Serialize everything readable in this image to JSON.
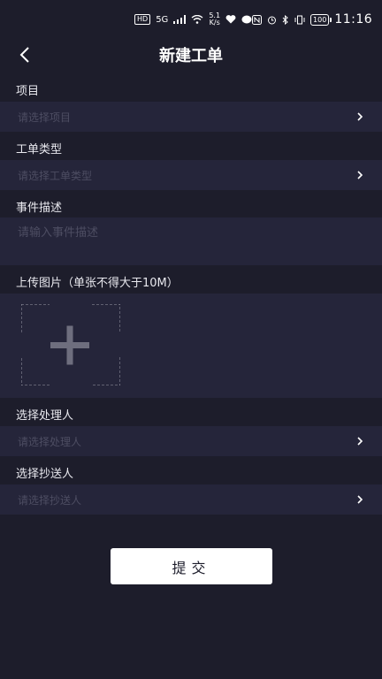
{
  "status_bar": {
    "hd": "HD",
    "network": "5G",
    "speed_value": "5.1",
    "speed_unit": "K/s",
    "battery": "100",
    "time": "11:16"
  },
  "header": {
    "title": "新建工单"
  },
  "form": {
    "project": {
      "label": "项目",
      "placeholder": "请选择项目"
    },
    "ticket_type": {
      "label": "工单类型",
      "placeholder": "请选择工单类型"
    },
    "event_description": {
      "label": "事件描述",
      "placeholder": "请输入事件描述"
    },
    "upload": {
      "label": "上传图片（单张不得大于10M）"
    },
    "handler": {
      "label": "选择处理人",
      "placeholder": "请选择处理人"
    },
    "cc": {
      "label": "选择抄送人",
      "placeholder": "请选择抄送人"
    }
  },
  "submit": {
    "label": "提交"
  },
  "icons": {
    "back": "chevron-left-icon",
    "field_arrow": "chevron-right-icon",
    "upload": "plus-icon"
  }
}
